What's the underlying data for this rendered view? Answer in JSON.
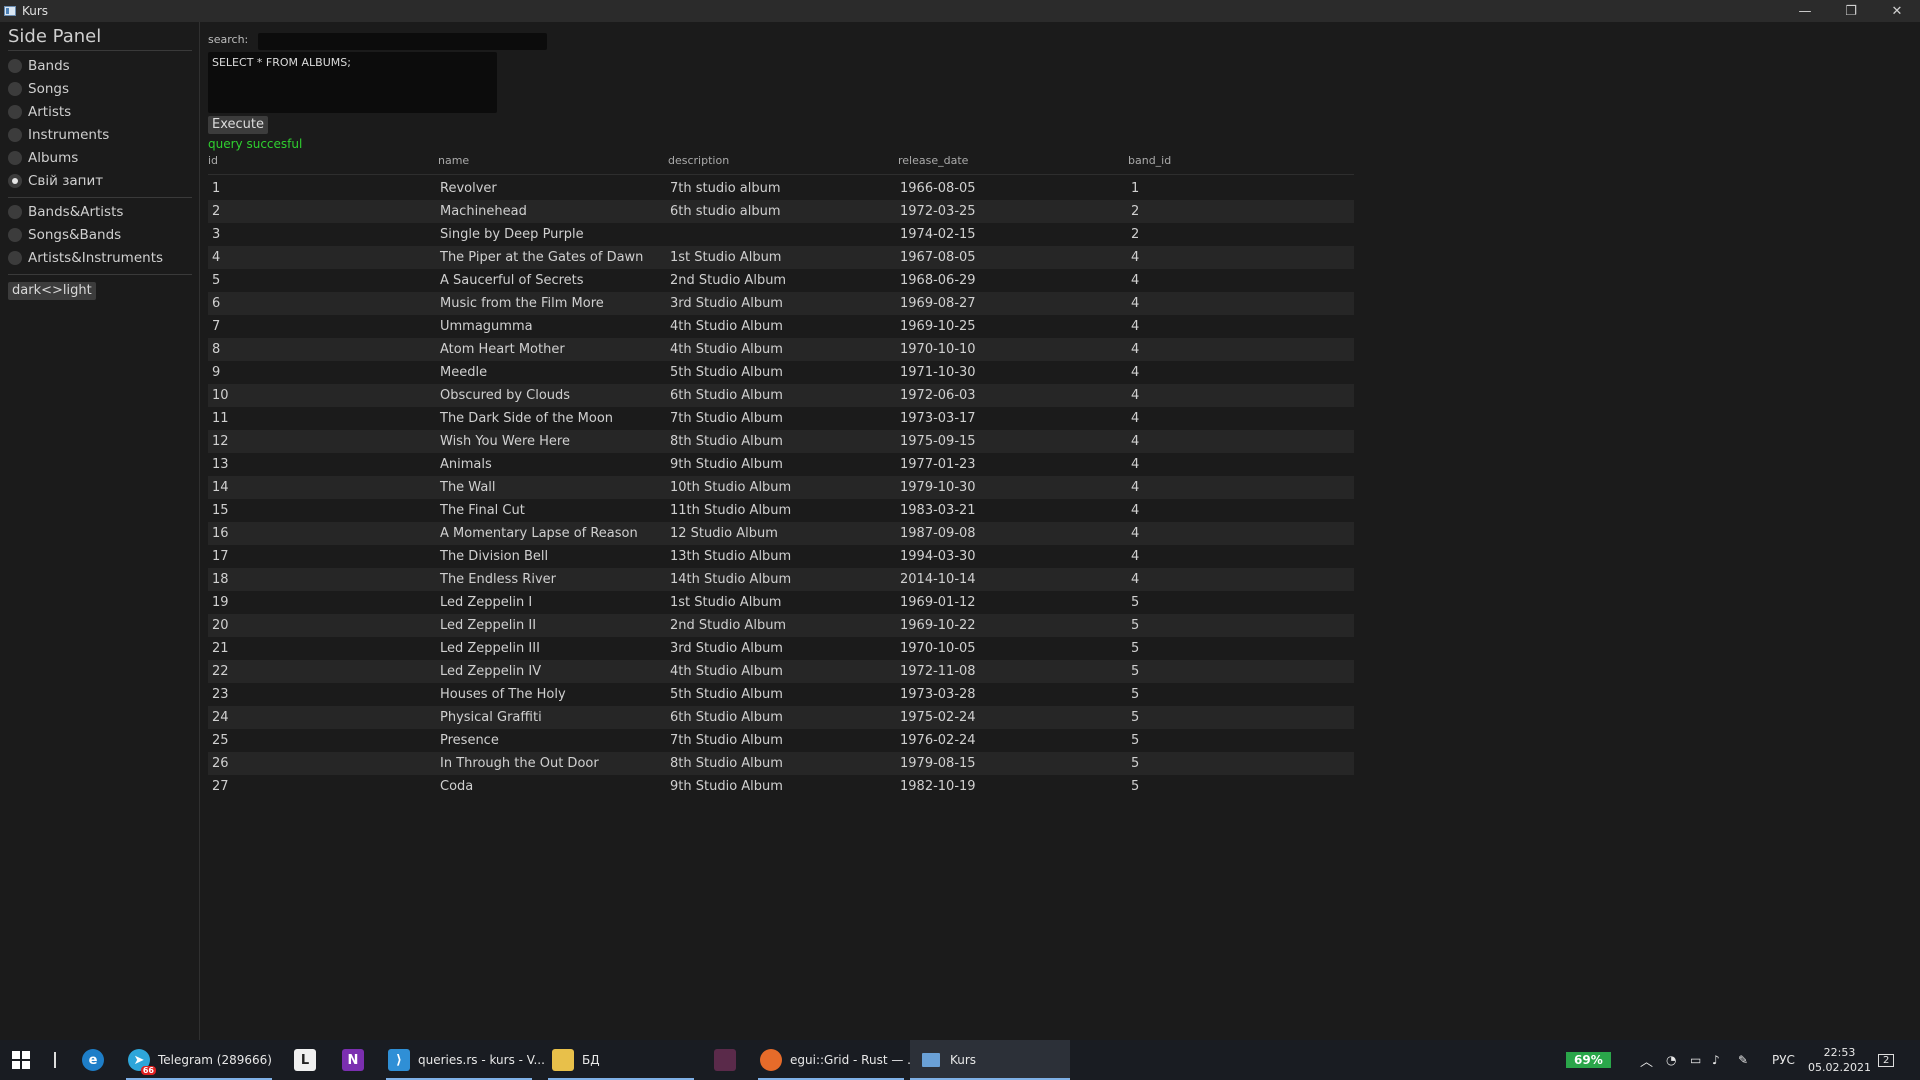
{
  "window": {
    "title": "Kurs",
    "controls": [
      "—",
      "❐",
      "✕"
    ]
  },
  "sidebar": {
    "title": "Side Panel",
    "items": [
      {
        "label": "Bands",
        "selected": false
      },
      {
        "label": "Songs",
        "selected": false
      },
      {
        "label": "Artists",
        "selected": false
      },
      {
        "label": "Instruments",
        "selected": false
      },
      {
        "label": "Albums",
        "selected": false
      },
      {
        "label": "Свій запит",
        "selected": true
      }
    ],
    "join_items": [
      {
        "label": "Bands&Artists",
        "selected": false
      },
      {
        "label": "Songs&Bands",
        "selected": false
      },
      {
        "label": "Artists&Instruments",
        "selected": false
      }
    ],
    "theme_toggle_label": "dark<>light"
  },
  "query": {
    "search_label": "search:",
    "search_value": "",
    "sql": "SELECT * FROM ALBUMS;",
    "execute_label": "Execute",
    "status": "query succesful",
    "status_color": "#2fd02f"
  },
  "table": {
    "columns": [
      "id",
      "name",
      "description",
      "release_date",
      "band_id"
    ],
    "rows": [
      [
        "1",
        "Revolver",
        "7th studio album",
        "1966-08-05",
        "1"
      ],
      [
        "2",
        "Machinehead",
        "6th studio album",
        "1972-03-25",
        "2"
      ],
      [
        "3",
        "Single by Deep Purple",
        "",
        "1974-02-15",
        "2"
      ],
      [
        "4",
        "The Piper at the Gates of Dawn",
        "1st Studio Album",
        "1967-08-05",
        "4"
      ],
      [
        "5",
        "A Saucerful of Secrets",
        "2nd Studio Album",
        "1968-06-29",
        "4"
      ],
      [
        "6",
        "Music from the Film More",
        "3rd Studio Album",
        "1969-08-27",
        "4"
      ],
      [
        "7",
        "Ummagumma",
        "4th Studio Album",
        "1969-10-25",
        "4"
      ],
      [
        "8",
        "Atom Heart Mother",
        "4th Studio Album",
        "1970-10-10",
        "4"
      ],
      [
        "9",
        "Meedle",
        "5th Studio Album",
        "1971-10-30",
        "4"
      ],
      [
        "10",
        "Obscured by Clouds",
        "6th Studio Album",
        "1972-06-03",
        "4"
      ],
      [
        "11",
        "The Dark Side of the Moon",
        "7th Studio Album",
        "1973-03-17",
        "4"
      ],
      [
        "12",
        "Wish You Were Here",
        "8th Studio Album",
        "1975-09-15",
        "4"
      ],
      [
        "13",
        "Animals",
        "9th Studio Album",
        "1977-01-23",
        "4"
      ],
      [
        "14",
        "The Wall",
        "10th Studio Album",
        "1979-10-30",
        "4"
      ],
      [
        "15",
        "The Final Cut",
        "11th Studio Album",
        "1983-03-21",
        "4"
      ],
      [
        "16",
        "A Momentary Lapse of Reason",
        "12 Studio Album",
        "1987-09-08",
        "4"
      ],
      [
        "17",
        "The Division Bell",
        "13th Studio Album",
        "1994-03-30",
        "4"
      ],
      [
        "18",
        "The Endless River",
        "14th Studio Album",
        "2014-10-14",
        "4"
      ],
      [
        "19",
        "Led Zeppelin I",
        "1st Studio Album",
        "1969-01-12",
        "5"
      ],
      [
        "20",
        "Led Zeppelin II",
        "2nd Studio Album",
        "1969-10-22",
        "5"
      ],
      [
        "21",
        "Led Zeppelin III",
        "3rd Studio Album",
        "1970-10-05",
        "5"
      ],
      [
        "22",
        "Led Zeppelin IV",
        "4th Studio Album",
        "1972-11-08",
        "5"
      ],
      [
        "23",
        "Houses of The Holy",
        "5th Studio Album",
        "1973-03-28",
        "5"
      ],
      [
        "24",
        "Physical Graffiti",
        "6th Studio Album",
        "1975-02-24",
        "5"
      ],
      [
        "25",
        "Presence",
        "7th Studio Album",
        "1976-02-24",
        "5"
      ],
      [
        "26",
        "In Through the Out Door",
        "8th Studio Album",
        "1979-08-15",
        "5"
      ],
      [
        "27",
        "Coda",
        "9th Studio Album",
        "1982-10-19",
        "5"
      ]
    ]
  },
  "taskbar": {
    "apps": [
      {
        "name": "telegram",
        "label": "Telegram (289666)",
        "badge": "66",
        "color": "#2ea6da"
      },
      {
        "name": "onenote",
        "glyph": "N",
        "color": "#7b2fb0"
      },
      {
        "name": "vscode",
        "label": "queries.rs - kurs - V...",
        "color": "#2f8fd6"
      },
      {
        "name": "explorer",
        "label": "БД",
        "color": "#e8c04a"
      },
      {
        "name": "firefox",
        "label": "egui::Grid - Rust — ...",
        "color": "#e66b2a"
      },
      {
        "name": "kurs",
        "label": "Kurs",
        "color": "#6aa0d6"
      }
    ],
    "l_app_glyph": "L",
    "battery": "69%",
    "language": "РУС",
    "time": "22:53",
    "date": "05.02.2021",
    "notifications": "2"
  }
}
